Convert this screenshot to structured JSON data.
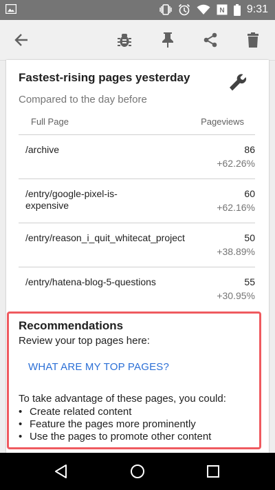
{
  "status_bar": {
    "time": "9:31",
    "icons": [
      "image-icon",
      "vibrate-icon",
      "alarm-icon",
      "wifi-icon",
      "signal-icon",
      "battery-icon"
    ]
  },
  "app_bar": {
    "icons": [
      "back-arrow-icon",
      "bug-icon",
      "pin-icon",
      "share-icon",
      "trash-icon"
    ]
  },
  "card": {
    "title": "Fastest-rising pages yesterday",
    "subtitle": "Compared to the day before",
    "col_page": "Full Page",
    "col_views": "Pageviews",
    "rows": [
      {
        "page": "/archive",
        "views": "86",
        "change": "+62.26%"
      },
      {
        "page": "/entry/google-pixel-is-expensive",
        "views": "60",
        "change": "+62.16%"
      },
      {
        "page": "/entry/reason_i_quit_whitecat_project",
        "views": "50",
        "change": "+38.89%"
      },
      {
        "page": "/entry/hatena-blog-5-questions",
        "views": "55",
        "change": "+30.95%"
      }
    ]
  },
  "recommendations": {
    "title": "Recommendations",
    "subtitle": "Review your top pages here:",
    "link": "WHAT ARE MY TOP PAGES?",
    "intro": "To take advantage of these pages, you could:",
    "items": [
      "Create related content",
      "Feature the pages more prominently",
      "Use the pages to promote other content"
    ]
  },
  "colors": {
    "accent_link": "#2b6fd6",
    "highlight_border": "#ef5a5f",
    "status_bar": "#757575"
  }
}
